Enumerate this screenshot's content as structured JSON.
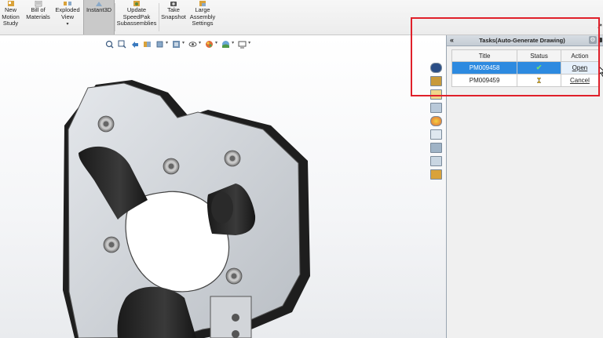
{
  "ribbon": {
    "buttons": [
      {
        "id": "new-motion-study",
        "label": "New\nMotion\nStudy",
        "icon": "motion-study-icon"
      },
      {
        "id": "bill-of-materials",
        "label": "Bill of\nMaterials",
        "icon": "bom-icon"
      },
      {
        "id": "exploded-view",
        "label": "Exploded\nView",
        "icon": "exploded-view-icon"
      },
      {
        "id": "instant3d",
        "label": "Instant3D",
        "icon": "instant3d-icon",
        "active": true
      },
      {
        "id": "update-speedpak",
        "label": "Update\nSpeedPak\nSubassemblies",
        "icon": "speedpak-icon"
      },
      {
        "id": "take-snapshot",
        "label": "Take\nSnapshot",
        "icon": "camera-icon"
      },
      {
        "id": "large-assembly-settings",
        "label": "Large\nAssembly\nSettings",
        "icon": "large-assembly-icon"
      }
    ]
  },
  "hud": {
    "icons": [
      "zoom-to-fit-icon",
      "zoom-area-icon",
      "previous-view-icon",
      "section-view-icon",
      "view-orientation-icon",
      "display-style-icon",
      "hide-show-icon",
      "edit-appearance-icon",
      "apply-scene-icon",
      "view-settings-icon"
    ]
  },
  "side_strip": {
    "icons": [
      "solidworks-resources-icon",
      "design-library-icon",
      "file-explorer-icon",
      "view-palette-icon",
      "appearances-icon",
      "custom-properties-icon",
      "3dcontent-icon",
      "forum-icon",
      "tasks-icon"
    ]
  },
  "task_pane": {
    "title": "Tasks(Auto-Generate Drawing)",
    "collapse_icon": "double-chevron-left-icon",
    "settings_icon": "gear-icon",
    "columns": [
      "Title",
      "Status",
      "Action"
    ],
    "rows": [
      {
        "title": "PM009458",
        "status": "complete",
        "status_icon": "checkmark-icon",
        "action": "Open",
        "selected": true
      },
      {
        "title": "PM009459",
        "status": "pending",
        "status_icon": "hourglass-icon",
        "action": "Cancel",
        "selected": false
      }
    ]
  },
  "colors": {
    "selection": "#2d8ae0",
    "highlight_box": "#e0202a",
    "status_done": "#6fe06f"
  }
}
